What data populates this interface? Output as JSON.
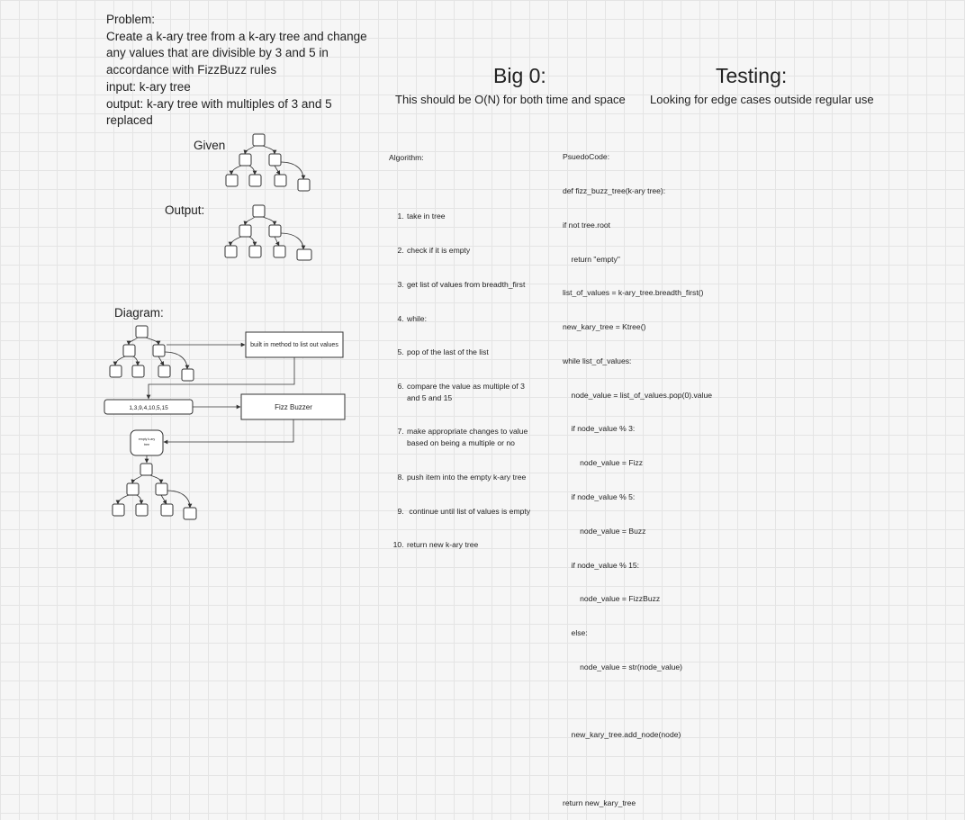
{
  "problem": {
    "lines": [
      "Problem:",
      "Create a k-ary tree from a k-ary tree and change any values that are divisible by 3 and 5 in accordance with FizzBuzz rules",
      "input: k-ary tree",
      "output: k-ary tree with multiples of 3 and 5 replaced"
    ]
  },
  "given_label": "Given",
  "output_label": "Output:",
  "diagram_label": "Diagram:",
  "big_o": {
    "title": "Big 0:",
    "subtitle": "This should be O(N) for both time and space"
  },
  "testing": {
    "title": "Testing:",
    "subtitle": "Looking for edge cases outside regular use"
  },
  "algorithm": {
    "title": "Algorithm:",
    "steps": [
      "take in tree",
      "check if it is empty",
      "get list of values from breadth_first",
      "while:",
      "pop of the last of the list",
      "compare the value as multiple of 3\nand 5 and 15",
      "make appropriate changes to value\nbased on being a multiple or no",
      "push item into the empty k-ary tree",
      " continue until list of values is empty",
      "return new k-ary tree"
    ]
  },
  "pseudocode": {
    "lines": [
      "PsuedoCode:",
      "def fizz_buzz_tree(k-ary tree):",
      "if not tree.root",
      "    return \"empty\"",
      "list_of_values = k-ary_tree.breadth_first()",
      "new_kary_tree = Ktree()",
      "while list_of_values:",
      "    node_value = list_of_values.pop(0).value",
      "    if node_value % 3:",
      "        node_value = Fizz",
      "    if node_value % 5:",
      "        node_value = Buzz",
      "    if node_value % 15:",
      "        node_value = FizzBuzz",
      "    else:",
      "        node_value = str(node_value)",
      "",
      "    new_kary_tree.add_node(node)",
      "",
      "return new_kary_tree"
    ]
  },
  "flow": {
    "builtin_label": "built in method to list out values",
    "values_label": "1,3,9,4,10,5,15",
    "fizz_label": "Fizz Buzzer",
    "empty_tree_label_1": "empty k-ary",
    "empty_tree_label_2": "tree"
  },
  "colors": {
    "background": "#f6f6f6",
    "grid": "#e4e4e4",
    "stroke": "#333333"
  }
}
